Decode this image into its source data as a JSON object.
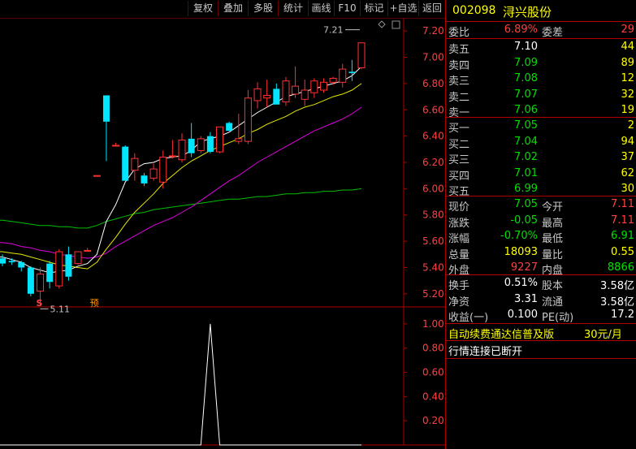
{
  "toolbar": {
    "buttons": [
      "复权",
      "叠加",
      "多股",
      "统计",
      "画线",
      "F10",
      "标记",
      "+自选",
      "返回"
    ]
  },
  "stock": {
    "code": "002098",
    "name": "浔兴股份"
  },
  "weibi": {
    "label": "委比",
    "value": "6.89%",
    "diff_label": "委差",
    "diff_value": "29"
  },
  "asks": [
    {
      "label": "卖五",
      "price": "7.10",
      "vol": "44"
    },
    {
      "label": "卖四",
      "price": "7.09",
      "vol": "89"
    },
    {
      "label": "卖三",
      "price": "7.08",
      "vol": "12"
    },
    {
      "label": "卖二",
      "price": "7.07",
      "vol": "32"
    },
    {
      "label": "卖一",
      "price": "7.06",
      "vol": "19"
    }
  ],
  "bids": [
    {
      "label": "买一",
      "price": "7.05",
      "vol": "2"
    },
    {
      "label": "买二",
      "price": "7.04",
      "vol": "94"
    },
    {
      "label": "买三",
      "price": "7.02",
      "vol": "37"
    },
    {
      "label": "买四",
      "price": "7.01",
      "vol": "62"
    },
    {
      "label": "买五",
      "price": "6.99",
      "vol": "30"
    }
  ],
  "quote": [
    {
      "l1": "现价",
      "v1": "7.05",
      "l2": "今开",
      "v2": "7.11"
    },
    {
      "l1": "涨跌",
      "v1": "-0.05",
      "l2": "最高",
      "v2": "7.11"
    },
    {
      "l1": "涨幅",
      "v1": "-0.70%",
      "l2": "最低",
      "v2": "6.91"
    },
    {
      "l1": "总量",
      "v1": "18093",
      "l2": "量比",
      "v2": "0.55"
    },
    {
      "l1": "外盘",
      "v1": "9227",
      "l2": "内盘",
      "v2": "8866"
    }
  ],
  "fundamentals": [
    {
      "l1": "换手",
      "v1": "0.51%",
      "l2": "股本",
      "v2": "3.58亿"
    },
    {
      "l1": "净资",
      "v1": "3.31",
      "l2": "流通",
      "v2": "3.58亿"
    },
    {
      "l1": "收益(一)",
      "v1": "0.100",
      "l2": "PE(动)",
      "v2": "17.2"
    }
  ],
  "promo": {
    "text": "自动续费通达信普及版",
    "price": "30元/月"
  },
  "status": "行情连接已断开",
  "colors": {
    "up": "#ff3030",
    "down": "#00e6ff",
    "ma5": "#ffffff",
    "ma10": "#e8e800",
    "ma20": "#e000e0",
    "ma60": "#00c000",
    "frame": "#b00000"
  },
  "chart_data": {
    "type": "candlestick",
    "price_axis": {
      "ticks": [
        "7.20",
        "7.00",
        "6.80",
        "6.60",
        "6.40",
        "6.20",
        "6.00",
        "5.80",
        "5.60",
        "5.40",
        "5.20"
      ],
      "ylim": [
        5.1,
        7.3
      ]
    },
    "annotations": {
      "high": "7.21",
      "low": "5.11",
      "marker_s": "S",
      "marker_yu": "预"
    },
    "candles": [
      {
        "o": 5.47,
        "h": 5.5,
        "l": 5.41,
        "c": 5.43
      },
      {
        "o": 5.45,
        "h": 5.47,
        "l": 5.42,
        "c": 5.44
      },
      {
        "o": 5.44,
        "h": 5.45,
        "l": 5.37,
        "c": 5.4
      },
      {
        "o": 5.4,
        "h": 5.41,
        "l": 5.18,
        "c": 5.2
      },
      {
        "o": 5.22,
        "h": 5.4,
        "l": 5.11,
        "c": 5.35
      },
      {
        "o": 5.43,
        "h": 5.45,
        "l": 5.24,
        "c": 5.29
      },
      {
        "o": 5.26,
        "h": 5.54,
        "l": 5.24,
        "c": 5.52
      },
      {
        "o": 5.5,
        "h": 5.56,
        "l": 5.3,
        "c": 5.33
      },
      {
        "o": 5.43,
        "h": 5.52,
        "l": 5.42,
        "c": 5.52
      },
      {
        "o": 5.53,
        "h": 5.55,
        "l": 5.52,
        "c": 5.53
      },
      {
        "o": 6.1,
        "h": 6.1,
        "l": 6.1,
        "c": 6.1
      },
      {
        "o": 6.71,
        "h": 6.71,
        "l": 6.21,
        "c": 6.51
      },
      {
        "o": 6.33,
        "h": 6.35,
        "l": 6.33,
        "c": 6.33
      },
      {
        "o": 6.32,
        "h": 6.33,
        "l": 6.06,
        "c": 6.06
      },
      {
        "o": 6.14,
        "h": 6.27,
        "l": 6.06,
        "c": 6.23
      },
      {
        "o": 6.1,
        "h": 6.12,
        "l": 6.02,
        "c": 6.04
      },
      {
        "o": 6.08,
        "h": 6.19,
        "l": 6.06,
        "c": 6.15
      },
      {
        "o": 6.05,
        "h": 6.29,
        "l": 6.0,
        "c": 6.24
      },
      {
        "o": 6.25,
        "h": 6.37,
        "l": 6.23,
        "c": 6.25
      },
      {
        "o": 6.22,
        "h": 6.42,
        "l": 6.2,
        "c": 6.37
      },
      {
        "o": 6.38,
        "h": 6.5,
        "l": 6.24,
        "c": 6.27
      },
      {
        "o": 6.29,
        "h": 6.4,
        "l": 6.27,
        "c": 6.38
      },
      {
        "o": 6.4,
        "h": 6.43,
        "l": 6.27,
        "c": 6.28
      },
      {
        "o": 6.28,
        "h": 6.45,
        "l": 6.27,
        "c": 6.47
      },
      {
        "o": 6.5,
        "h": 6.51,
        "l": 6.48,
        "c": 6.44
      },
      {
        "o": 6.36,
        "h": 6.57,
        "l": 6.34,
        "c": 6.38
      },
      {
        "o": 6.36,
        "h": 6.75,
        "l": 6.34,
        "c": 6.69
      },
      {
        "o": 6.67,
        "h": 6.81,
        "l": 6.61,
        "c": 6.76
      },
      {
        "o": 6.69,
        "h": 6.83,
        "l": 6.62,
        "c": 6.71
      },
      {
        "o": 6.76,
        "h": 6.8,
        "l": 6.64,
        "c": 6.64
      },
      {
        "o": 6.66,
        "h": 6.85,
        "l": 6.63,
        "c": 6.82
      },
      {
        "o": 6.72,
        "h": 6.93,
        "l": 6.69,
        "c": 6.78
      },
      {
        "o": 6.68,
        "h": 6.83,
        "l": 6.63,
        "c": 6.75
      },
      {
        "o": 6.73,
        "h": 6.84,
        "l": 6.69,
        "c": 6.82
      },
      {
        "o": 6.75,
        "h": 6.84,
        "l": 6.73,
        "c": 6.81
      },
      {
        "o": 6.81,
        "h": 6.85,
        "l": 6.79,
        "c": 6.84
      },
      {
        "o": 6.81,
        "h": 6.95,
        "l": 6.77,
        "c": 6.91
      },
      {
        "o": 6.89,
        "h": 6.98,
        "l": 6.82,
        "c": 6.88
      },
      {
        "o": 6.92,
        "h": 7.11,
        "l": 6.91,
        "c": 7.11
      }
    ],
    "ma5": [
      5.48,
      5.46,
      5.44,
      5.4,
      5.38,
      5.36,
      5.37,
      5.38,
      5.41,
      5.43,
      5.5,
      5.75,
      5.88,
      6.05,
      6.15,
      6.19,
      6.2,
      6.23,
      6.24,
      6.25,
      6.29,
      6.36,
      6.38,
      6.4,
      6.43,
      6.48,
      6.53,
      6.58,
      6.62,
      6.66,
      6.7,
      6.72,
      6.74,
      6.76,
      6.78,
      6.8,
      6.82,
      6.86,
      6.93
    ],
    "ma10": [
      5.52,
      5.51,
      5.5,
      5.48,
      5.46,
      5.44,
      5.42,
      5.41,
      5.4,
      5.39,
      5.44,
      5.54,
      5.63,
      5.73,
      5.82,
      5.89,
      5.96,
      6.04,
      6.1,
      6.16,
      6.21,
      6.25,
      6.29,
      6.32,
      6.35,
      6.38,
      6.42,
      6.45,
      6.49,
      6.52,
      6.55,
      6.59,
      6.62,
      6.64,
      6.67,
      6.7,
      6.72,
      6.75,
      6.8
    ],
    "ma20": [
      5.59,
      5.58,
      5.56,
      5.55,
      5.53,
      5.52,
      5.5,
      5.49,
      5.48,
      5.47,
      5.48,
      5.51,
      5.56,
      5.6,
      5.64,
      5.68,
      5.72,
      5.75,
      5.78,
      5.82,
      5.86,
      5.91,
      5.96,
      6.01,
      6.06,
      6.1,
      6.15,
      6.2,
      6.24,
      6.28,
      6.32,
      6.36,
      6.4,
      6.44,
      6.47,
      6.5,
      6.53,
      6.57,
      6.62
    ],
    "ma60": [
      5.76,
      5.75,
      5.74,
      5.73,
      5.72,
      5.72,
      5.71,
      5.71,
      5.7,
      5.7,
      5.72,
      5.75,
      5.77,
      5.79,
      5.81,
      5.82,
      5.84,
      5.85,
      5.86,
      5.87,
      5.88,
      5.89,
      5.9,
      5.91,
      5.92,
      5.92,
      5.93,
      5.94,
      5.94,
      5.95,
      5.96,
      5.96,
      5.97,
      5.97,
      5.98,
      5.98,
      5.99,
      5.99,
      6.0
    ],
    "indicator": {
      "ticks": [
        "1.00",
        "0.80",
        "0.60",
        "0.40",
        "0.20"
      ],
      "ylim": [
        0,
        1.1
      ],
      "values": [
        0,
        0,
        0,
        0,
        0,
        0,
        0,
        0,
        0,
        0,
        0,
        0,
        0,
        0,
        0,
        0,
        0,
        0,
        0,
        0,
        0,
        0,
        1,
        0,
        0,
        0,
        0,
        0,
        0,
        0,
        0,
        0,
        0,
        0,
        0,
        0,
        0,
        0,
        0
      ]
    }
  }
}
